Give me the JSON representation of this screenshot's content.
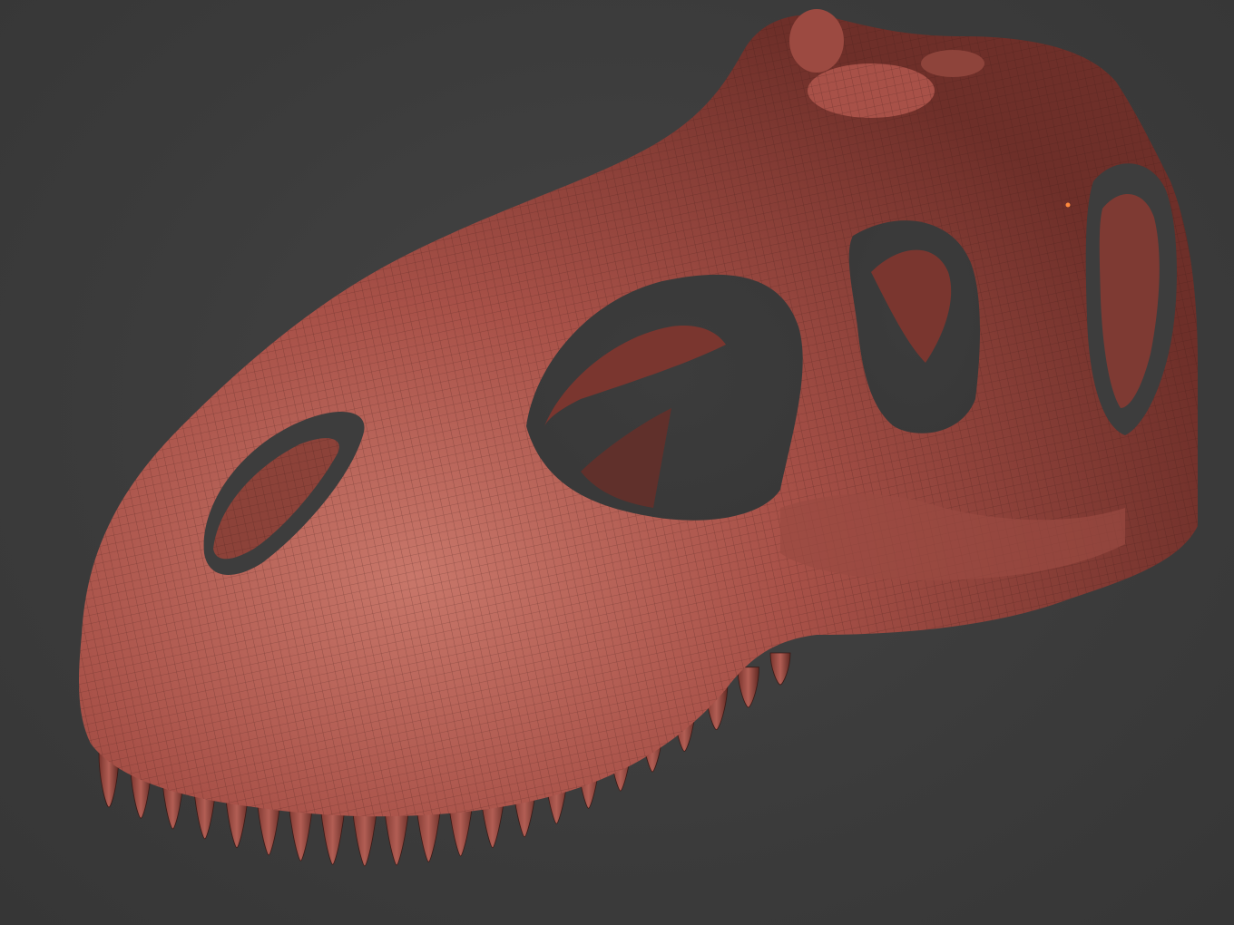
{
  "viewport": {
    "background": "#3c3c3c",
    "mesh_color": "#a85148",
    "mesh_shadow": "#5e2822",
    "mesh_highlight": "#c8776a",
    "wire_color": "#3a1a16"
  },
  "model": {
    "subject": "dinosaur-skull",
    "shading": "wireframe-on-shaded",
    "teeth_count": 22
  }
}
